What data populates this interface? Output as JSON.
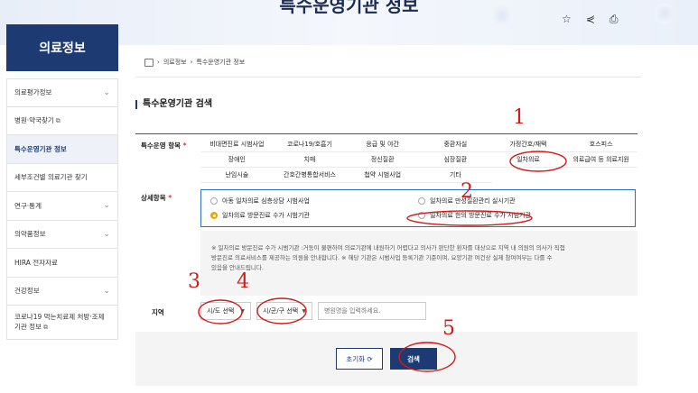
{
  "banner": {
    "title": "특수운영기관 정보"
  },
  "top_icons": [
    "star-icon",
    "share-icon",
    "print-icon"
  ],
  "sidebar": {
    "title": "의료정보",
    "items": [
      {
        "label": "의료평가정보",
        "chevron": true
      },
      {
        "label": "병원·약국찾기",
        "external": true
      },
      {
        "label": "특수운영기관 정보",
        "active": true
      },
      {
        "label": "세부조건별 의료기관 찾기"
      },
      {
        "label": "연구·통계",
        "chevron": true
      },
      {
        "label": "의약품정보",
        "chevron": true
      },
      {
        "label": "HIRA 전자자료"
      },
      {
        "label": "건강정보",
        "chevron": true
      },
      {
        "label": "코로나19 먹는치료제 처방·조제기관 정보",
        "external": true
      }
    ]
  },
  "breadcrumb": [
    "의료정보",
    "특수운영기관 정보"
  ],
  "section_title": "특수운영기관 검색",
  "form": {
    "type_label": "특수운영 항목",
    "required_mark": "*",
    "types": [
      "비대면진료 시범사업",
      "코로나19/호흡기",
      "응급 및 야간",
      "중환자실",
      "가정간호/재택",
      "호스피스",
      "장애인",
      "치매",
      "정신질환",
      "심장질환",
      "일차의료",
      "의료급여 등 의료지원",
      "난임시술",
      "간호간병통합서비스",
      "첩약 시범사업",
      "기타"
    ],
    "detail_label": "상세항목",
    "detail_options": [
      {
        "label": "아동 일차의료 심층상담 시범사업",
        "selected": false
      },
      {
        "label": "일차의료 만성질환관리 실시기관",
        "selected": false
      },
      {
        "label": "일차의료 방문진료 수가 시범기관",
        "selected": true
      },
      {
        "label": "일차의료 한의 방문진료 수가 시범기관",
        "selected": false
      }
    ],
    "note_line1": "※ 일차의료 방문진료 수가 시범기관 :거동이 불편하여 의료기관에 내원하기 어렵다고 의사가 판단한 환자를 대상으로 지역 내 의원의 의사가 직접",
    "note_line2": "방문진료 의료서비스를 제공하는 의원을 안내합니다. ※ 해당 기관은 시범사업 등록기관 기준이며, 요양기관 여건상 실제 참여여부는 다를 수",
    "note_line3": "있음을 안내드립니다.",
    "region_label": "지역",
    "sido_select": "시/도 선택",
    "sigungu_select": "시/군/구 선택",
    "hospital_placeholder": "병원명을 입력하세요.",
    "reset_label": "초기화",
    "search_label": "검색"
  },
  "annotations": [
    "1",
    "2",
    "3",
    "4",
    "5"
  ],
  "colors": {
    "navy": "#1d3a73",
    "accent_blue": "#2d6fc4",
    "radio_on": "#f0a500",
    "annotation_red": "#d21a1a"
  }
}
